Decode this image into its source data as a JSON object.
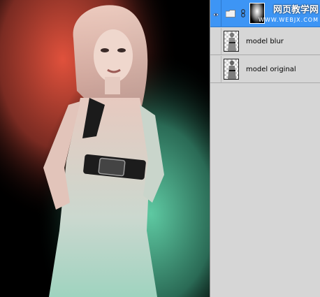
{
  "document": {
    "canvas": {
      "subject": "model-photo",
      "gradient_colors": {
        "top_left": "#e0513c",
        "bottom_right": "#55c29b",
        "background": "#000000"
      }
    }
  },
  "layers_panel": {
    "selection_color": "#3d95f5",
    "group_row": {
      "visibility_icon": "eye-icon",
      "folder_icon": "folder-icon",
      "link_icon": "chain-link-icon",
      "mask_icon": "mask-thumbnail"
    },
    "layers": [
      {
        "label": "model blur",
        "visibility_icon": "blank"
      },
      {
        "label": "model original",
        "visibility_icon": "blank"
      }
    ]
  },
  "watermark": {
    "main": "网页教学网",
    "sub": "WWW.WEBJX.COM"
  }
}
